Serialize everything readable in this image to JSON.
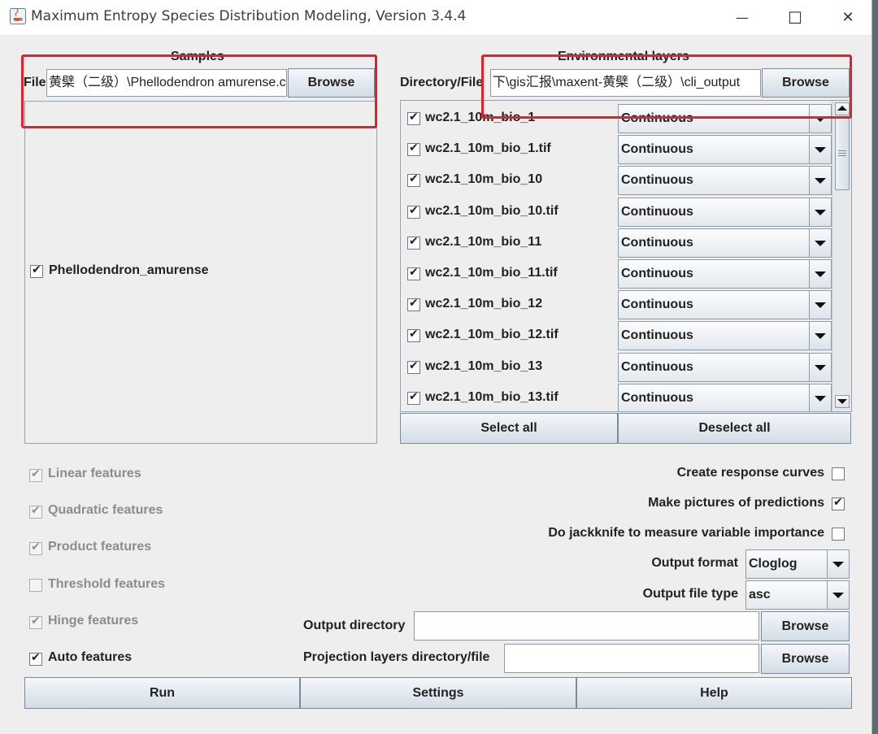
{
  "window": {
    "title": "Maximum Entropy Species Distribution Modeling, Version 3.4.4",
    "minimize": "—",
    "maximize": "☐",
    "close": "✕"
  },
  "samples": {
    "section_title": "Samples",
    "file_label": "File",
    "file_value": "黄檗（二级）\\Phellodendron amurense.csv",
    "browse": "Browse",
    "species": [
      {
        "label": "Phellodendron_amurense",
        "checked": true
      }
    ]
  },
  "env": {
    "section_title": "Environmental layers",
    "dir_label": "Directory/File",
    "dir_value": "下\\gis汇报\\maxent-黄檗（二级）\\cli_output",
    "browse": "Browse",
    "layers": [
      {
        "name": "wc2.1_10m_bio_1",
        "type": "Continuous"
      },
      {
        "name": "wc2.1_10m_bio_1.tif",
        "type": "Continuous"
      },
      {
        "name": "wc2.1_10m_bio_10",
        "type": "Continuous"
      },
      {
        "name": "wc2.1_10m_bio_10.tif",
        "type": "Continuous"
      },
      {
        "name": "wc2.1_10m_bio_11",
        "type": "Continuous"
      },
      {
        "name": "wc2.1_10m_bio_11.tif",
        "type": "Continuous"
      },
      {
        "name": "wc2.1_10m_bio_12",
        "type": "Continuous"
      },
      {
        "name": "wc2.1_10m_bio_12.tif",
        "type": "Continuous"
      },
      {
        "name": "wc2.1_10m_bio_13",
        "type": "Continuous"
      },
      {
        "name": "wc2.1_10m_bio_13.tif",
        "type": "Continuous"
      }
    ],
    "select_all": "Select all",
    "deselect_all": "Deselect all"
  },
  "features": {
    "linear": "Linear features",
    "quadratic": "Quadratic features",
    "product": "Product features",
    "threshold": "Threshold features",
    "hinge": "Hinge features",
    "auto": "Auto features"
  },
  "options": {
    "response_curves": "Create response curves",
    "make_pictures": "Make pictures of predictions",
    "jackknife": "Do jackknife to measure variable importance",
    "output_format_label": "Output format",
    "output_format_value": "Cloglog",
    "output_type_label": "Output file type",
    "output_type_value": "asc",
    "output_dir_label": "Output directory",
    "output_dir_value": "",
    "proj_label": "Projection layers directory/file",
    "proj_value": "",
    "browse": "Browse"
  },
  "bottom": {
    "run": "Run",
    "settings": "Settings",
    "help": "Help"
  }
}
